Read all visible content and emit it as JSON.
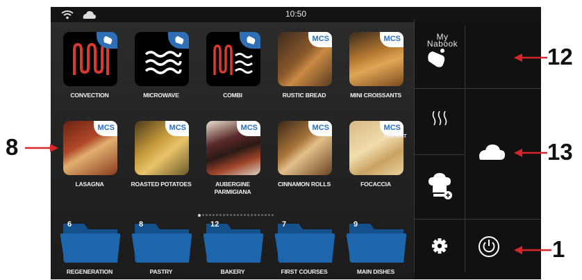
{
  "status": {
    "time": "10:50",
    "icons": [
      "wifi-icon",
      "cloud-icon"
    ]
  },
  "modes": [
    {
      "label": "CONVECTION",
      "icon": "convection-icon"
    },
    {
      "label": "MICROWAVE",
      "icon": "microwave-icon"
    },
    {
      "label": "COMBI",
      "icon": "combi-icon"
    }
  ],
  "recipes_row1": [
    {
      "label": "RUSTIC BREAD",
      "badge": "MCS"
    },
    {
      "label": "MINI CROISSANTS",
      "badge": "MCS"
    }
  ],
  "recipes_row2": [
    {
      "label": "LASAGNA",
      "badge": "MCS"
    },
    {
      "label": "ROASTED POTATOES",
      "badge": "MCS"
    },
    {
      "label": "AUBERGINE\nPARMIGIANA",
      "label_line1": "AUBERGINE",
      "label_line2": "PARMIGIANA",
      "badge": "MCS"
    },
    {
      "label": "CINNAMON ROLLS",
      "badge": "MCS"
    },
    {
      "label": "FOCACCIA",
      "badge": "MCS"
    }
  ],
  "folders": [
    {
      "label": "REGENERATION",
      "count": "6"
    },
    {
      "label": "PASTRY",
      "count": "8"
    },
    {
      "label": "BAKERY",
      "count": "12"
    },
    {
      "label": "FIRST COURSES",
      "count": "7"
    },
    {
      "label": "MAIN DISHES",
      "count": "9"
    }
  ],
  "page_dots": {
    "total": 22,
    "active": 0
  },
  "side": {
    "manual_icon": "hand-icon",
    "preheat_label": "PREHEAT",
    "chef_add_icon": "chef-hat-plus-icon",
    "settings_icon": "gear-icon",
    "mybook_line1": "My",
    "mybook_line2": "Nabook",
    "cloud_icon": "cloud-icon",
    "power_icon": "power-icon"
  },
  "callouts": {
    "c8": "8",
    "c12": "12",
    "c13": "13",
    "c1": "1"
  },
  "colors": {
    "accent_blue": "#2f6fb6",
    "folder_blue": "#1d66ad",
    "heater_red": "#d83a2f",
    "callout_red": "#d7262b"
  }
}
